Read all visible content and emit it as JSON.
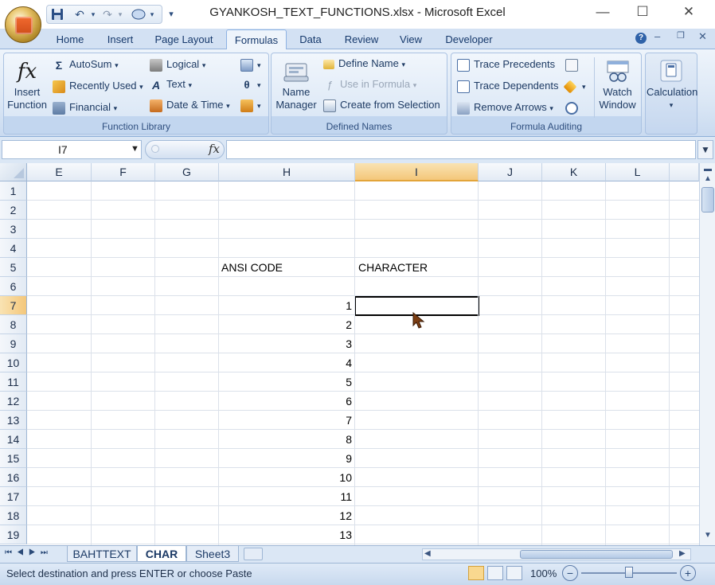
{
  "window": {
    "title": "GYANKOSH_TEXT_FUNCTIONS.xlsx - Microsoft Excel",
    "minimize": "—",
    "maximize": "☐",
    "close": "✕"
  },
  "ribbon_tabs": [
    "Home",
    "Insert",
    "Page Layout",
    "Formulas",
    "Data",
    "Review",
    "View",
    "Developer"
  ],
  "active_tab": "Formulas",
  "function_library": {
    "label": "Function Library",
    "insert_function": [
      "Insert",
      "Function"
    ],
    "fx": "fx",
    "autosum": "AutoSum",
    "recently_used": "Recently Used",
    "financial": "Financial",
    "logical": "Logical",
    "text": "Text",
    "date_time": "Date & Time"
  },
  "defined_names": {
    "label": "Defined Names",
    "name_manager": [
      "Name",
      "Manager"
    ],
    "define_name": "Define Name",
    "use_in_formula": "Use in Formula",
    "create_from_selection": "Create from Selection"
  },
  "formula_auditing": {
    "label": "Formula Auditing",
    "trace_precedents": "Trace Precedents",
    "trace_dependents": "Trace Dependents",
    "remove_arrows": "Remove Arrows",
    "watch_window": [
      "Watch",
      "Window"
    ]
  },
  "calculation": {
    "label": "Calculation"
  },
  "formula_bar": {
    "name_box": "I7",
    "fx": "fx",
    "value": ""
  },
  "columns": [
    "E",
    "F",
    "G",
    "H",
    "I",
    "J",
    "K",
    "L"
  ],
  "rows": [
    "1",
    "2",
    "3",
    "4",
    "5",
    "6",
    "7",
    "8",
    "9",
    "10",
    "11",
    "12",
    "13",
    "14",
    "15",
    "16",
    "17",
    "18",
    "19"
  ],
  "cells": {
    "H5": "ANSI CODE",
    "I5": "CHARACTER",
    "H_values": [
      "1",
      "2",
      "3",
      "4",
      "5",
      "6",
      "7",
      "8",
      "9",
      "10",
      "11",
      "12",
      "13"
    ]
  },
  "sheet_tabs": [
    "BAHTTEXT",
    "CHAR",
    "Sheet3"
  ],
  "active_sheet": "CHAR",
  "status": {
    "message": "Select destination and press ENTER or choose Paste",
    "zoom": "100%"
  },
  "colors": {
    "accent": "#2b579a",
    "ribbon": "#dbe7f5",
    "selection": "#e8f0fa"
  }
}
